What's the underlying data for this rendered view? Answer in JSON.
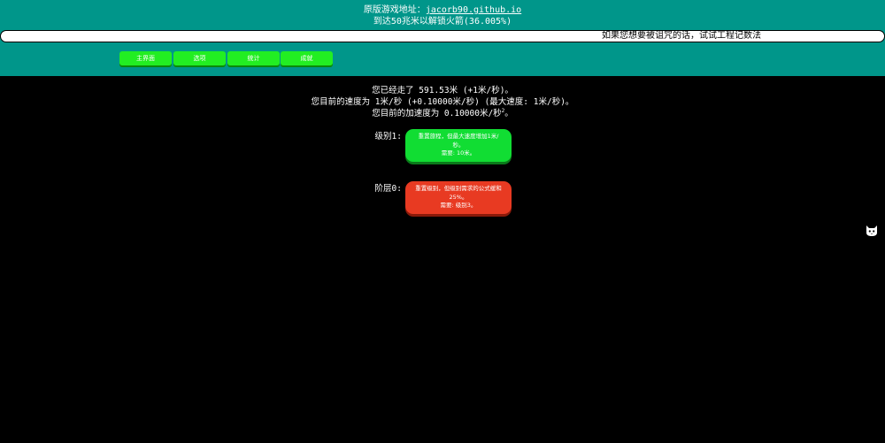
{
  "header": {
    "original_prefix": "原版游戏地址：",
    "original_link": "jacorb90.github.io",
    "goal": "到达50兆米以解锁火箭(36.005%)",
    "news": "如果您想要被诅咒的话，试试工程记数法"
  },
  "tabs": [
    {
      "label": "主界面"
    },
    {
      "label": "选项"
    },
    {
      "label": "统计"
    },
    {
      "label": "成就"
    }
  ],
  "stats": {
    "distance": "您已经走了 591.53米 (+1米/秒)。",
    "velocity": "您目前的速度为 1米/秒 (+0.10000米/秒) (最大速度: 1米/秒)。",
    "acceleration": "您目前的加速度为 0.10000米/秒",
    "acceleration_exp": "2",
    "acceleration_end": "。"
  },
  "resets": [
    {
      "label": "级别1:",
      "line1": "重置旅程，但最大速度增加1米/秒。",
      "line2": "需要: 10米。",
      "color": "#11dd33"
    },
    {
      "label": "阶层0:",
      "line1": "重置级别，但级别需求的公式缓和25%。",
      "line2": "需要: 级别3。",
      "color": "#e83a22"
    }
  ],
  "side": {
    "icon": "cat-icon"
  },
  "colors": {
    "header_bg": "#00968a",
    "page_bg": "#000000",
    "tab_bg": "#22ee22"
  }
}
